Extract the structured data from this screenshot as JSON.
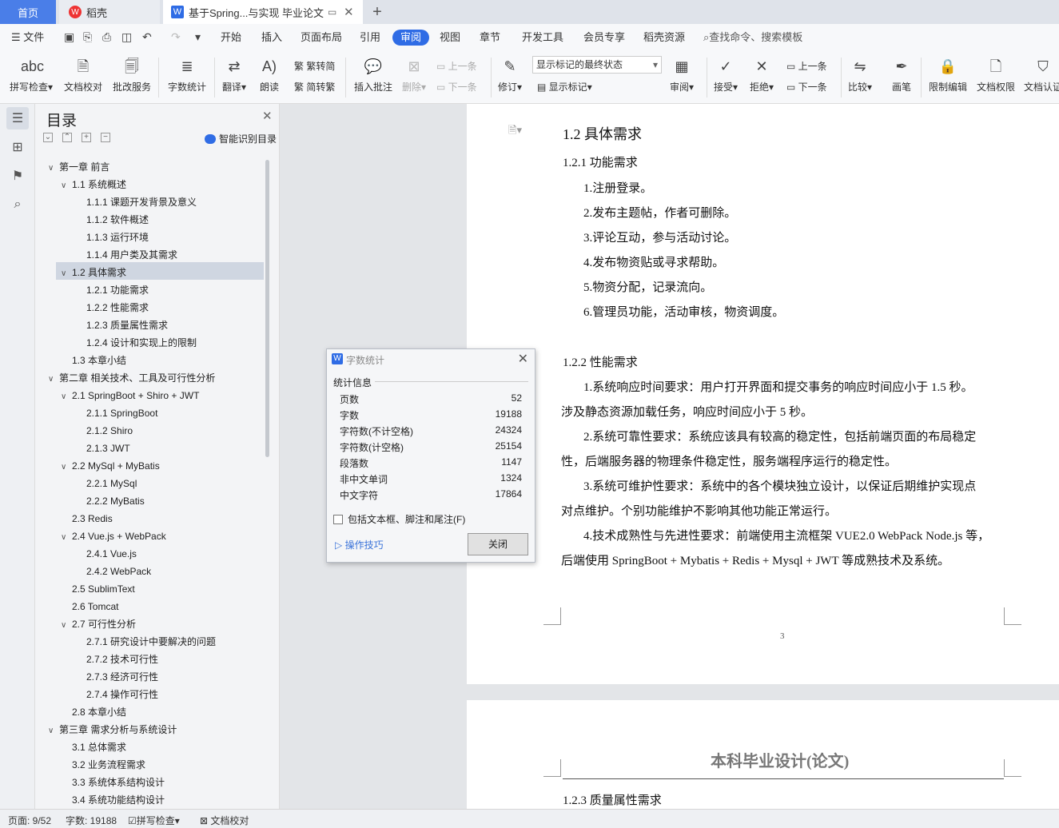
{
  "tabs": {
    "home": "首页",
    "daoke": "稻壳",
    "doc": "基于Spring...与实现 毕业论文"
  },
  "menu": {
    "file": "文件",
    "items": [
      "开始",
      "插入",
      "页面布局",
      "引用",
      "审阅",
      "视图",
      "章节",
      "开发工具",
      "会员专享",
      "稻壳资源"
    ],
    "search": "查找命令、搜索模板"
  },
  "ribbon": {
    "spell": "拼写检查",
    "proof": "文档校对",
    "batch": "批改服务",
    "wordcount": "字数统计",
    "translate": "翻译",
    "read": "朗读",
    "to_trad": "繁转简",
    "to_simp": "简转繁",
    "insert_comment": "插入批注",
    "delete": "删除",
    "prev": "上一条",
    "next": "下一条",
    "track": "修订",
    "mode": "显示标记的最终状态",
    "show_marks": "显示标记",
    "review": "审阅",
    "accept": "接受",
    "reject": "拒绝",
    "prev2": "上一条",
    "next2": "下一条",
    "compare": "比较",
    "pen": "画笔",
    "restrict": "限制编辑",
    "rights": "文档权限",
    "auth": "文档认证"
  },
  "toc": {
    "title": "目录",
    "smart": "智能识别目录",
    "items": [
      "第一章 前言",
      "1.1 系统概述",
      "1.1.1 课题开发背景及意义",
      "1.1.2 软件概述",
      "1.1.3 运行环境",
      "1.1.4 用户类及其需求",
      "1.2 具体需求",
      "1.2.1 功能需求",
      "1.2.2 性能需求",
      "1.2.3 质量属性需求",
      "1.2.4 设计和实现上的限制",
      "1.3 本章小结",
      "第二章 相关技术、工具及可行性分析",
      "2.1 SpringBoot + Shiro + JWT",
      "2.1.1 SpringBoot",
      "2.1.2 Shiro",
      "2.1.3 JWT",
      "2.2 MySql + MyBatis",
      "2.2.1 MySql",
      "2.2.2 MyBatis",
      "2.3 Redis",
      "2.4 Vue.js + WebPack",
      "2.4.1 Vue.js",
      "2.4.2 WebPack",
      "2.5 SublimText",
      "2.6 Tomcat",
      "2.7 可行性分析",
      "2.7.1 研究设计中要解决的问题",
      "2.7.2 技术可行性",
      "2.7.3 经济可行性",
      "2.7.4 操作可行性",
      "2.8 本章小结",
      "第三章 需求分析与系统设计",
      "3.1 总体需求",
      "3.2 业务流程需求",
      "3.3 系统体系结构设计",
      "3.4 系统功能结构设计"
    ]
  },
  "doc": {
    "h12": "1.2 具体需求",
    "h121": "1.2.1 功能需求",
    "func": [
      "1.注册登录。",
      "2.发布主题帖，作者可删除。",
      "3.评论互动，参与活动讨论。",
      "4.发布物资贴或寻求帮助。",
      "5.物资分配，记录流向。",
      "6.管理员功能，活动审核，物资调度。"
    ],
    "h122": "1.2.2 性能需求",
    "perf": [
      "1.系统响应时间要求：用户打开界面和提交事务的响应时间应小于 1.5 秒。",
      "涉及静态资源加载任务，响应时间应小于 5 秒。",
      "2.系统可靠性要求：系统应该具有较高的稳定性，包括前端页面的布局稳定",
      "性，后端服务器的物理条件稳定性，服务端程序运行的稳定性。",
      "3.系统可维护性要求：系统中的各个模块独立设计，以保证后期维护实现点",
      "对点维护。个别功能维护不影响其他功能正常运行。",
      "4.技术成熟性与先进性要求：前端使用主流框架 VUE2.0 WebPack Node.js 等，",
      "后端使用 SpringBoot + Mybatis + Redis + Mysql + JWT 等成熟技术及系统。"
    ],
    "pagenum": "3",
    "header2": "本科毕业设计(论文)",
    "h123": "1.2.3 质量属性需求"
  },
  "dialog": {
    "title": "字数统计",
    "section": "统计信息",
    "rows": [
      [
        "页数",
        "52"
      ],
      [
        "字数",
        "19188"
      ],
      [
        "字符数(不计空格)",
        "24324"
      ],
      [
        "字符数(计空格)",
        "25154"
      ],
      [
        "段落数",
        "1147"
      ],
      [
        "非中文单词",
        "1324"
      ],
      [
        "中文字符",
        "17864"
      ]
    ],
    "checkbox": "包括文本框、脚注和尾注(F)",
    "tips": "操作技巧",
    "close": "关闭"
  },
  "status": {
    "page": "页面: 9/52",
    "words": "字数: 19188",
    "spell": "拼写检查",
    "proof": "文档校对"
  }
}
